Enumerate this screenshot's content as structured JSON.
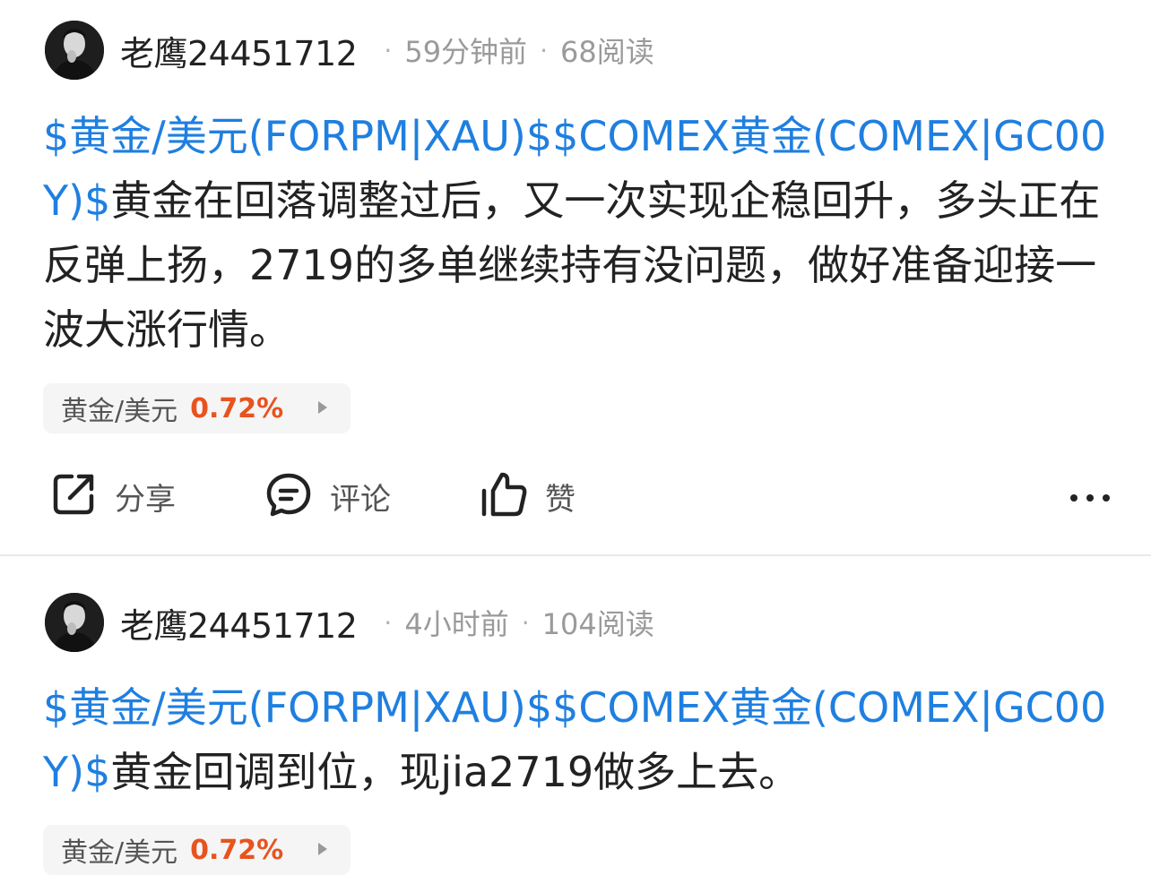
{
  "posts": [
    {
      "author": "老鹰24451712",
      "time": "59分钟前",
      "reads": "68阅读",
      "tags": "$黄金/美元(FORPM|XAU)$$COMEX黄金(COMEX|GC00Y)$",
      "text": "黄金在回落调整过后，又一次实现企稳回升，多头正在反弹上扬，2719的多单继续持有没问题，做好准备迎接一波大涨行情。",
      "stock": {
        "name": "黄金/美元",
        "change": "0.72%"
      },
      "actions": {
        "share": "分享",
        "comment": "评论",
        "like": "赞"
      }
    },
    {
      "author": "老鹰24451712",
      "time": "4小时前",
      "reads": "104阅读",
      "tags": "$黄金/美元(FORPM|XAU)$$COMEX黄金(COMEX|GC00Y)$",
      "text": "黄金回调到位，现jia2719做多上去。",
      "stock": {
        "name": "黄金/美元",
        "change": "0.72%"
      }
    }
  ],
  "meta_separator": "·",
  "colors": {
    "tag": "#1f7fe0",
    "change_up": "#e8531e",
    "divider": "#e9e9e9"
  },
  "icons": {
    "share": "share-icon",
    "comment": "comment-icon",
    "like": "thumbs-up-icon",
    "more": "more-icon",
    "chip_arrow": "triangle-right-icon"
  }
}
